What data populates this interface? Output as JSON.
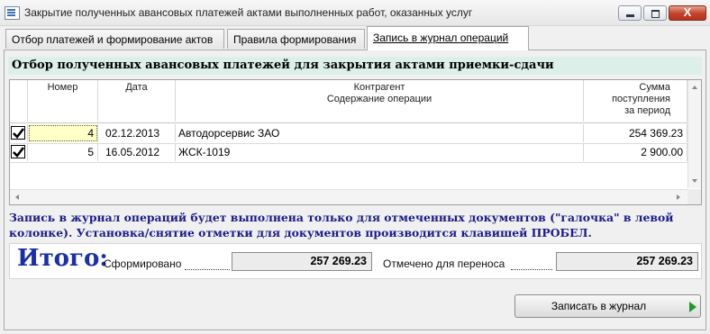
{
  "window": {
    "title": "Закрытие полученных авансовых платежей актами выполненных работ, оказанных услуг",
    "close_label": "X"
  },
  "tabs": [
    {
      "label": "Отбор платежей и формирование актов",
      "active": false
    },
    {
      "label": "Правила формирования",
      "active": false
    },
    {
      "label": "Запись в журнал операций",
      "active": true
    }
  ],
  "section_title": "Отбор полученных авансовых платежей для закрытия актами приемки-сдачи",
  "grid": {
    "headers": {
      "number": "Номер",
      "date": "Дата",
      "counterparty_l1": "Контрагент",
      "counterparty_l2": "Содержание операции",
      "sum_l1": "Сумма",
      "sum_l2": "поступления",
      "sum_l3": "за период"
    },
    "rows": [
      {
        "checked": true,
        "number": "4",
        "date": "02.12.2013",
        "counterparty": "Автодорсервис ЗАО",
        "sum": "254 369.23"
      },
      {
        "checked": true,
        "number": "5",
        "date": "16.05.2012",
        "counterparty": "ЖСК-1019",
        "sum": "2 900.00"
      }
    ]
  },
  "note": "Запись в журнал операций будет выполнена только для отмеченных документов  (\"галочка\" в левой колонке). Установка/снятие отметки для документов производится клавишей ПРОБЕЛ.",
  "totals": {
    "title": "Итого:",
    "formed_label": "Сформировано",
    "formed_value": "257 269.23",
    "marked_label": "Отмечено для переноса",
    "marked_value": "257 269.23"
  },
  "actions": {
    "write_label": "Записать в журнал"
  },
  "colors": {
    "section_bg": "#dcefe8",
    "note_text": "#1b1b8a",
    "itogo_text": "#1a2fa8",
    "selected_cell": "#ffffc8",
    "play_icon": "#1e9a2c"
  },
  "icons": [
    "app-icon",
    "minimize-icon",
    "maximize-icon",
    "close-icon",
    "checkmark-icon",
    "scroll-up-icon",
    "scroll-down-icon",
    "scroll-left-icon",
    "scroll-right-icon",
    "play-icon"
  ]
}
